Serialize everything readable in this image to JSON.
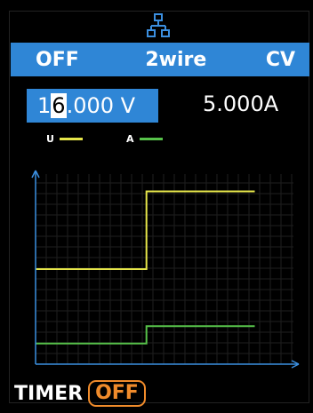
{
  "status": {
    "output_state": "OFF",
    "sense_mode": "2wire",
    "reg_mode": "CV"
  },
  "readout": {
    "voltage_prefix": "1",
    "voltage_cursor_digit": "6",
    "voltage_suffix": ".000 V",
    "current": "5.000A"
  },
  "legend": {
    "voltage_label": "U",
    "current_label": "A",
    "voltage_color": "#e6e64a",
    "current_color": "#57c24a"
  },
  "timer": {
    "label": "TIMER",
    "state": "OFF",
    "badge_color": "#f08b2b"
  },
  "accent_color": "#2f86d6",
  "chart_data": {
    "type": "line",
    "series": [
      {
        "name": "U",
        "points": [
          [
            0,
            0.55
          ],
          [
            0.43,
            0.55
          ],
          [
            0.43,
            1.0
          ],
          [
            0.85,
            1.0
          ]
        ]
      },
      {
        "name": "A",
        "points": [
          [
            0,
            0.12
          ],
          [
            0.43,
            0.12
          ],
          [
            0.43,
            0.22
          ],
          [
            0.85,
            0.22
          ]
        ]
      }
    ],
    "xlim": [
      0,
      1
    ],
    "ylim": [
      0,
      1.1
    ],
    "grid": true
  }
}
